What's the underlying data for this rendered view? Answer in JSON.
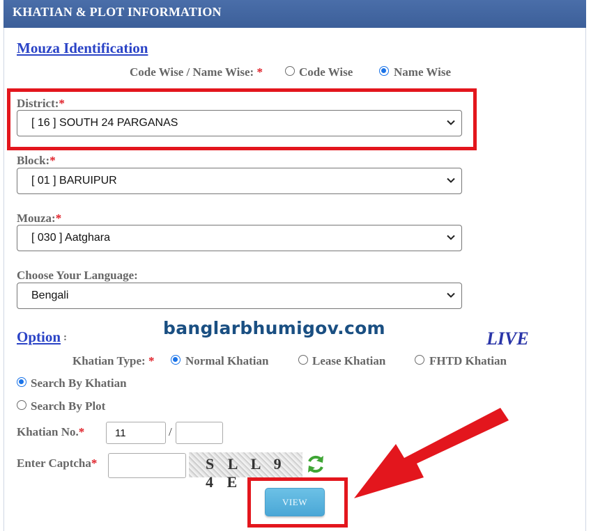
{
  "header": {
    "title": "KHATIAN & PLOT INFORMATION"
  },
  "mouza_section": {
    "title": "Mouza Identification",
    "code_name_label": "Code Wise / Name Wise:",
    "required_mark": "*",
    "code_wise_label": "Code Wise",
    "name_wise_label": "Name Wise",
    "selected": "Name Wise"
  },
  "district": {
    "label": "District:",
    "value": "[ 16 ] SOUTH 24 PARGANAS"
  },
  "block": {
    "label": "Block:",
    "value": "[ 01 ] BARUIPUR"
  },
  "mouza": {
    "label": "Mouza:",
    "value": "[ 030 ] Aatghara"
  },
  "language": {
    "label": "Choose Your Language:",
    "value": "Bengali"
  },
  "option_section": {
    "title": "Option",
    "colon": ":",
    "khatian_type_label": "Khatian Type:",
    "types": [
      "Normal Khatian",
      "Lease Khatian",
      "FHTD Khatian"
    ],
    "selected_type": "Normal Khatian",
    "search_by_khatian": "Search By Khatian",
    "search_by_plot": "Search By Plot",
    "search_selected": "Search By Khatian"
  },
  "khatian_no": {
    "label": "Khatian No.",
    "value": "11",
    "separator": "/",
    "value2": ""
  },
  "captcha": {
    "label": "Enter Captcha",
    "value": "",
    "image_text": "S L L 9 4 E"
  },
  "view_button": {
    "label": "VIEW"
  },
  "overlay": {
    "watermark": "banglarbhumigov.com",
    "live": "LIVE"
  },
  "colors": {
    "header": "#3c5f99",
    "link": "#2a43c6",
    "highlight": "#e3161d",
    "button": "#4aa7d6"
  }
}
